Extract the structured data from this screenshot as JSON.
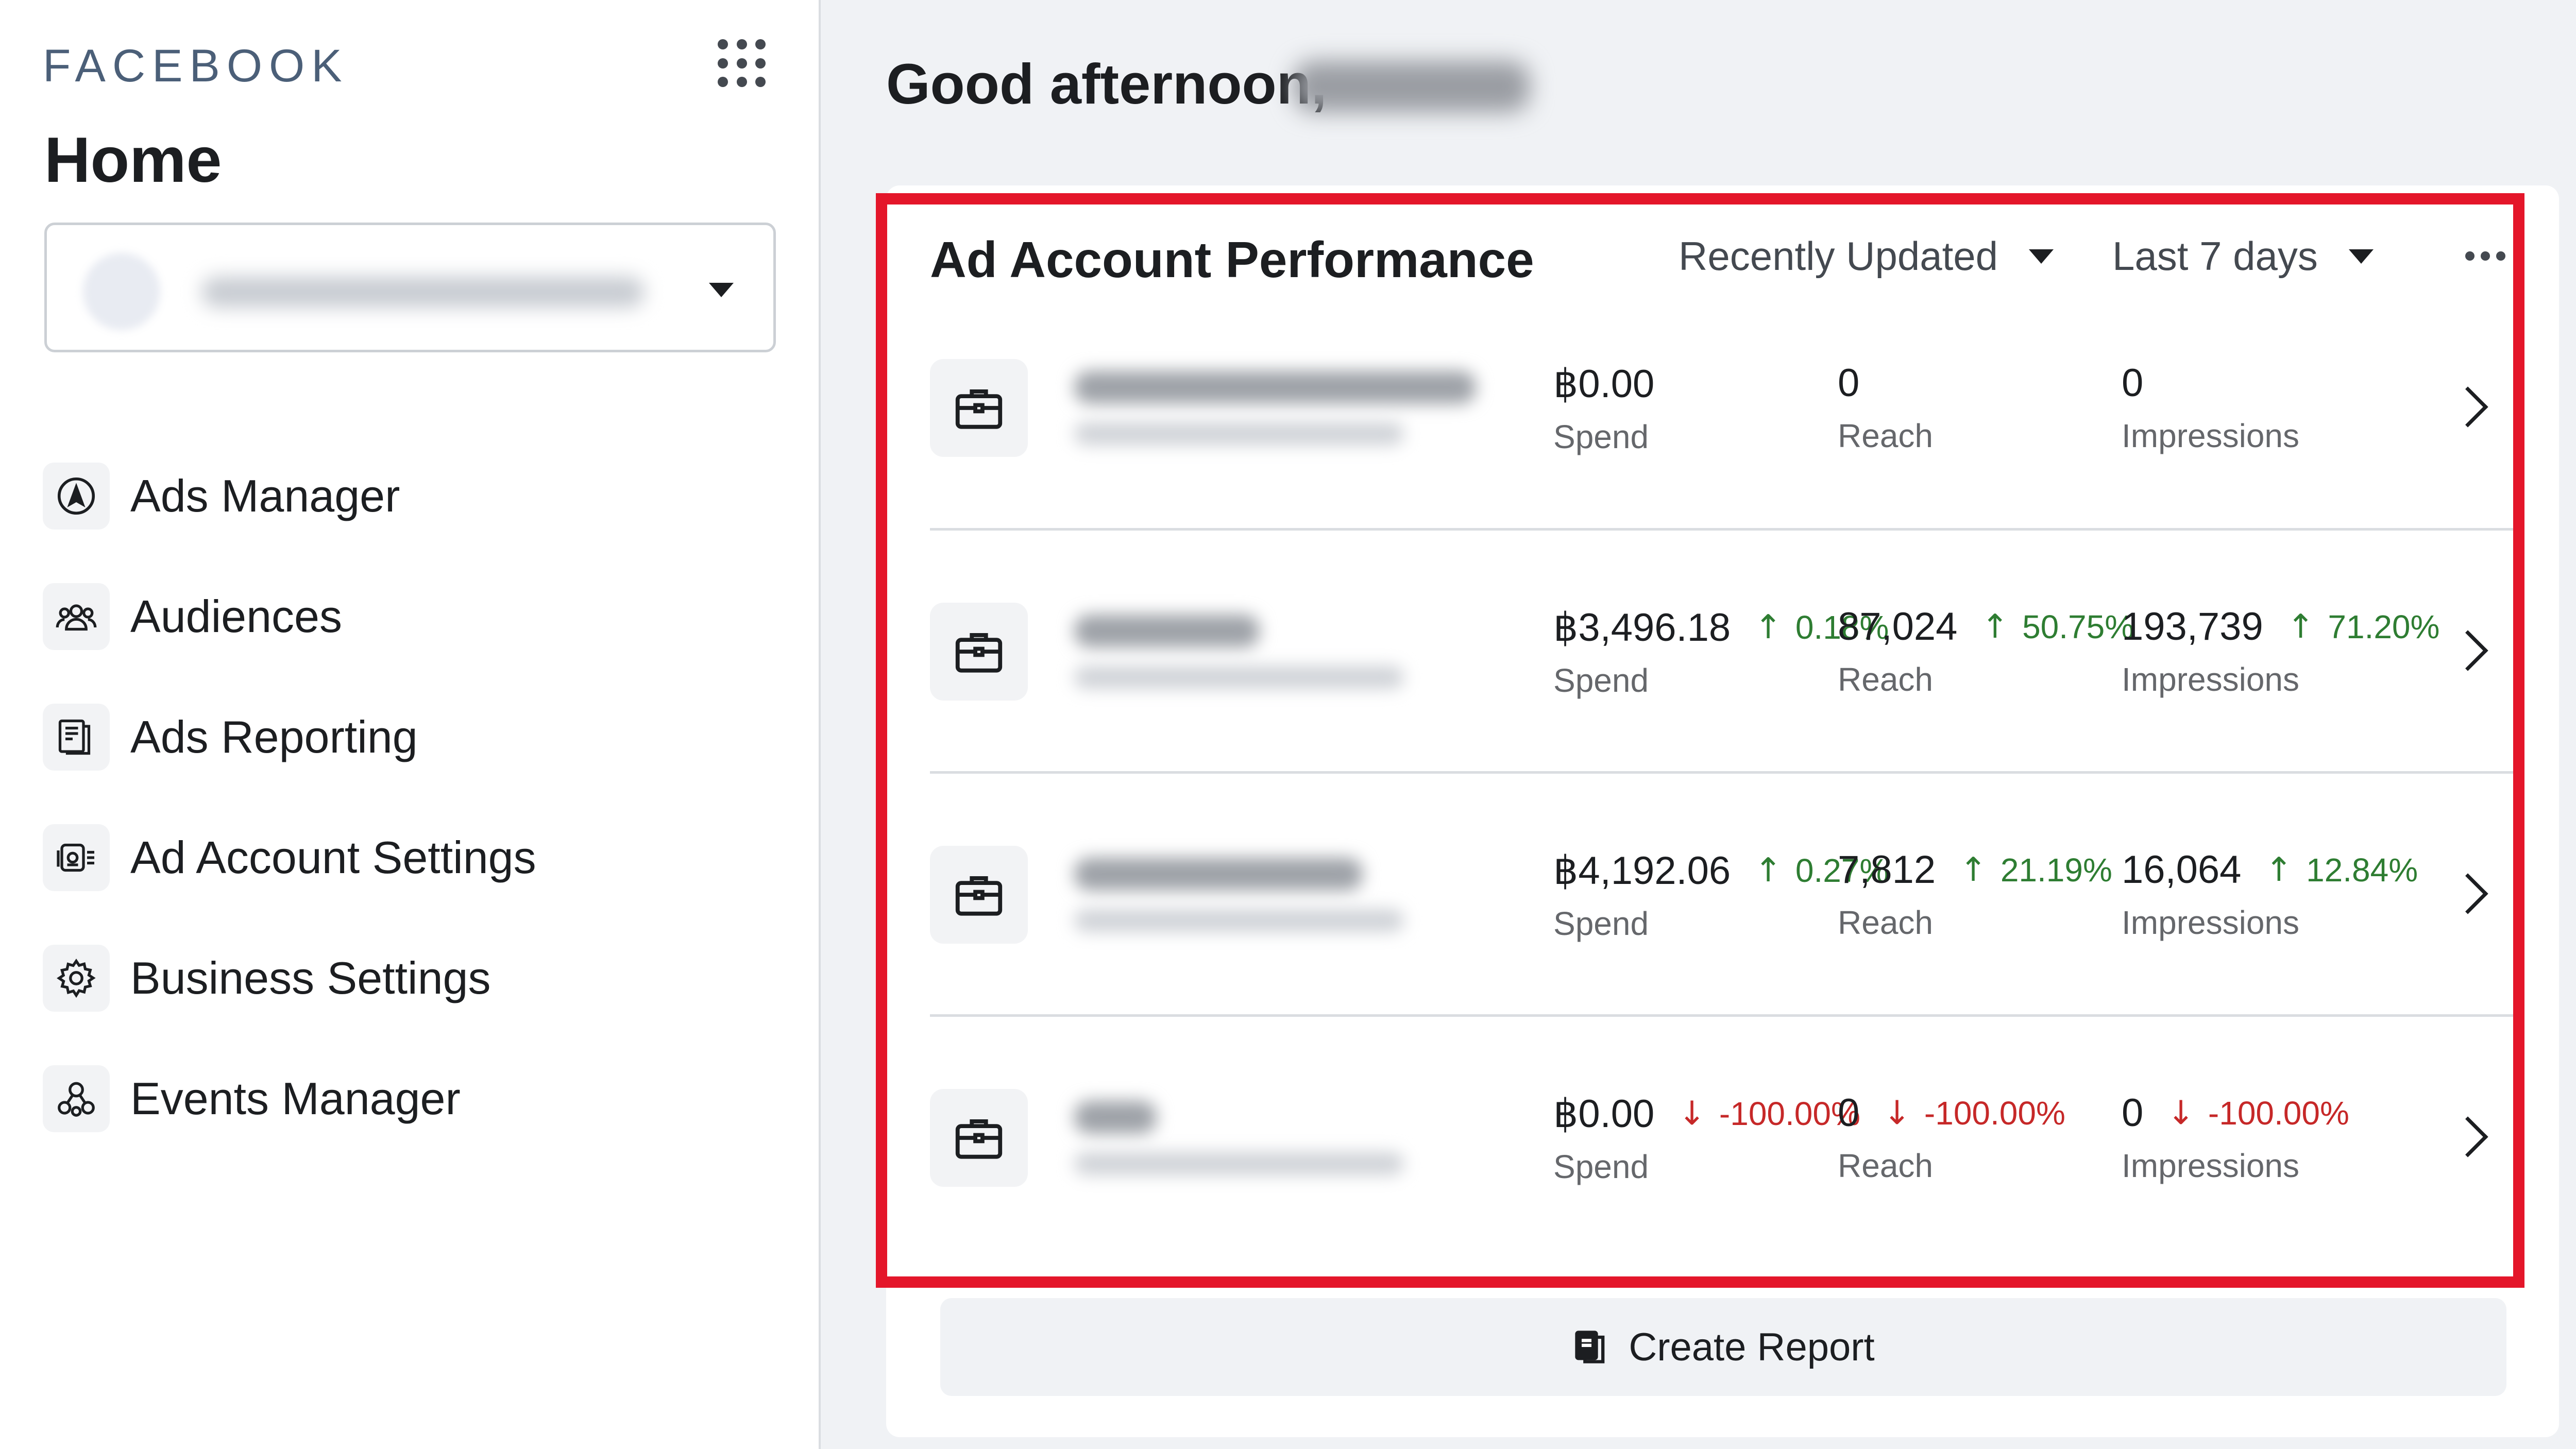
{
  "brand": "FACEBOOK",
  "sidebar": {
    "title": "Home",
    "nav": [
      {
        "label": "Ads Manager",
        "icon": "ads-manager-icon"
      },
      {
        "label": "Audiences",
        "icon": "audiences-icon"
      },
      {
        "label": "Ads Reporting",
        "icon": "ads-reporting-icon"
      },
      {
        "label": "Ad Account Settings",
        "icon": "ad-account-settings-icon"
      },
      {
        "label": "Business Settings",
        "icon": "gear-icon"
      },
      {
        "label": "Events Manager",
        "icon": "events-manager-icon"
      }
    ]
  },
  "main": {
    "greeting": "Good afternoon,"
  },
  "card": {
    "title": "Ad Account Performance",
    "sort_filter": "Recently Updated",
    "date_filter": "Last 7 days",
    "metric_labels": {
      "spend": "Spend",
      "reach": "Reach",
      "impressions": "Impressions"
    },
    "rows": [
      {
        "spend": "฿0.00",
        "spend_delta": "",
        "reach": "0",
        "reach_delta": "",
        "impressions": "0",
        "impressions_delta": ""
      },
      {
        "spend": "฿3,496.18",
        "spend_delta": "0.18%",
        "reach": "87,024",
        "reach_delta": "50.75%",
        "impressions": "193,739",
        "impressions_delta": "71.20%"
      },
      {
        "spend": "฿4,192.06",
        "spend_delta": "0.27%",
        "reach": "7,812",
        "reach_delta": "21.19%",
        "impressions": "16,064",
        "impressions_delta": "12.84%"
      },
      {
        "spend": "฿0.00",
        "spend_delta": "-100.00%",
        "reach": "0",
        "reach_delta": "-100.00%",
        "impressions": "0",
        "impressions_delta": "-100.00%"
      }
    ],
    "create_report": "Create Report"
  },
  "colors": {
    "highlight": "#e4162a",
    "up": "#2e7d32",
    "down": "#c62828"
  }
}
